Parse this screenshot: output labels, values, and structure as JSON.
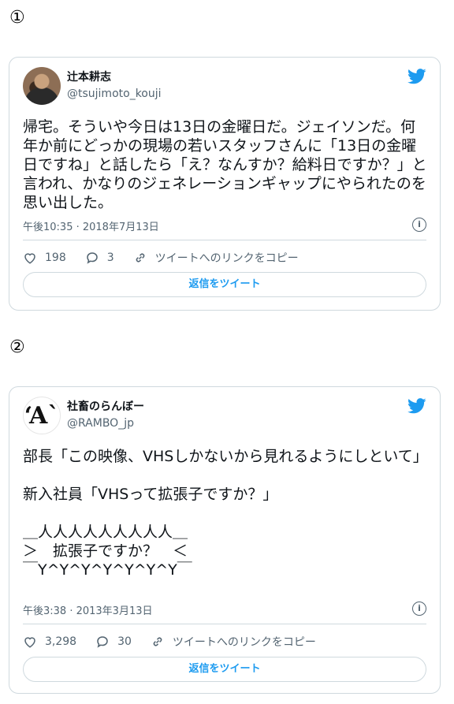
{
  "tweets": [
    {
      "marker": "①",
      "display_name": "辻本耕志",
      "handle": "@tsujimoto_kouji",
      "text": "帰宅。そういや今日は13日の金曜日だ。ジェイソンだ。何年か前にどっかの現場の若いスタッフさんに「13日の金曜日ですね」と話したら「え？なんすか？給料日ですか？」と言われ、かなりのジェネレーションギャップにやられたのを思い出した。",
      "timestamp": "午後10:35 · 2018年7月13日",
      "likes": "198",
      "replies": "3",
      "copy_link": "ツイートへのリンクをコピー",
      "reply_button": "返信をツイート"
    },
    {
      "marker": "②",
      "display_name": "社畜のらんぼー",
      "handle": "@RAMBO_jp",
      "avatar_text": "‘A`",
      "text": "部長「この映像、VHSしかないから見れるようにしといて」\n\n新入社員「VHSって拡張子ですか？」\n\n＿人人人人人人人人人＿\n＞　拡張子ですか？　＜\n￣Y^Y^Y^Y^Y^Y^Y￣",
      "timestamp": "午後3:38 · 2013年3月13日",
      "likes": "3,298",
      "replies": "30",
      "copy_link": "ツイートへのリンクをコピー",
      "reply_button": "返信をツイート"
    }
  ],
  "colors": {
    "accent": "#1d9bf0",
    "muted": "#536471",
    "border": "#cfd9de"
  },
  "icons": [
    "twitter-bird-icon",
    "heart-icon",
    "reply-bubble-icon",
    "link-icon",
    "info-icon"
  ]
}
